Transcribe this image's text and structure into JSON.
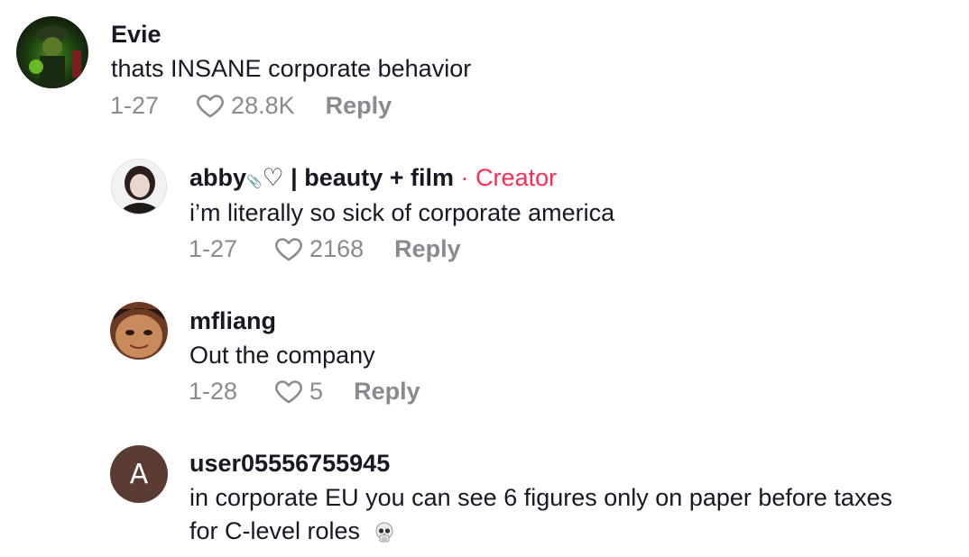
{
  "comments": [
    {
      "username": "Evie",
      "text": "thats INSANE corporate behavior",
      "date": "1-27",
      "likes": "28.8K",
      "reply_label": "Reply"
    },
    {
      "username": "abby",
      "username_suffix": "♡ | beauty + film",
      "creator_separator": "·",
      "creator_label": "Creator",
      "text": "i’m literally so sick of corporate america",
      "date": "1-27",
      "likes": "2168",
      "reply_label": "Reply"
    },
    {
      "username": "mfliang",
      "text": "Out the company",
      "date": "1-28",
      "likes": "5",
      "reply_label": "Reply"
    },
    {
      "username": "user05556755945",
      "avatar_letter": "A",
      "text_line1": "in corporate EU you can see 6 figures only on paper before taxes",
      "text_line2": "for C-level roles",
      "emoji_icon": "skull-icon"
    }
  ],
  "colors": {
    "text": "#161823",
    "meta": "#8a8b91",
    "creator": "#fe2c55",
    "avatar_letter_bg": "#5b3c33"
  }
}
